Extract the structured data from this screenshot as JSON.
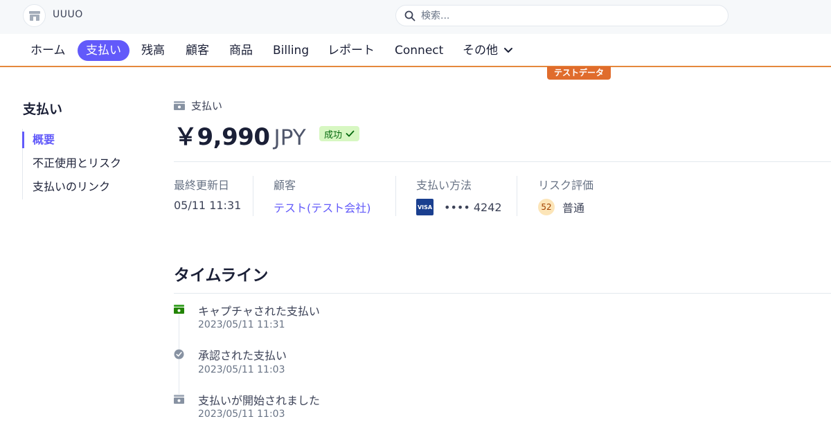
{
  "header": {
    "account_name": "UUUO",
    "search_placeholder": "検索..."
  },
  "nav": {
    "items": [
      "ホーム",
      "支払い",
      "残高",
      "顧客",
      "商品",
      "Billing",
      "レポート",
      "Connect",
      "その他"
    ],
    "active": "支払い"
  },
  "test_mode_badge": "テストデータ",
  "sidebar": {
    "title": "支払い",
    "items": [
      "概要",
      "不正使用とリスク",
      "支払いのリンク"
    ],
    "active": "概要"
  },
  "payment": {
    "breadcrumb": "支払い",
    "amount": "￥9,990",
    "currency": "JPY",
    "status": "成功",
    "details": [
      {
        "label": "最終更新日",
        "value": "05/11 11:31"
      },
      {
        "label": "顧客",
        "value": "テスト(テスト会社)"
      },
      {
        "label": "支払い方法",
        "value": "•••• 4242",
        "card_brand": "VISA"
      },
      {
        "label": "リスク評価",
        "value": "普通",
        "score": "52"
      }
    ]
  },
  "timeline": {
    "title": "タイムライン",
    "events": [
      {
        "text": "キャプチャされた支払い",
        "time": "2023/05/11 11:31",
        "icon": "payment-captured-icon"
      },
      {
        "text": "承認された支払い",
        "time": "2023/05/11 11:03",
        "icon": "check-circle-icon"
      },
      {
        "text": "支払いが開始されました",
        "time": "2023/05/11 11:03",
        "icon": "payment-started-icon"
      }
    ]
  },
  "colors": {
    "accent": "#625afa",
    "test_mode": "#e06c2c",
    "success_bg": "#d7f7c2",
    "success_text": "#05690d"
  }
}
